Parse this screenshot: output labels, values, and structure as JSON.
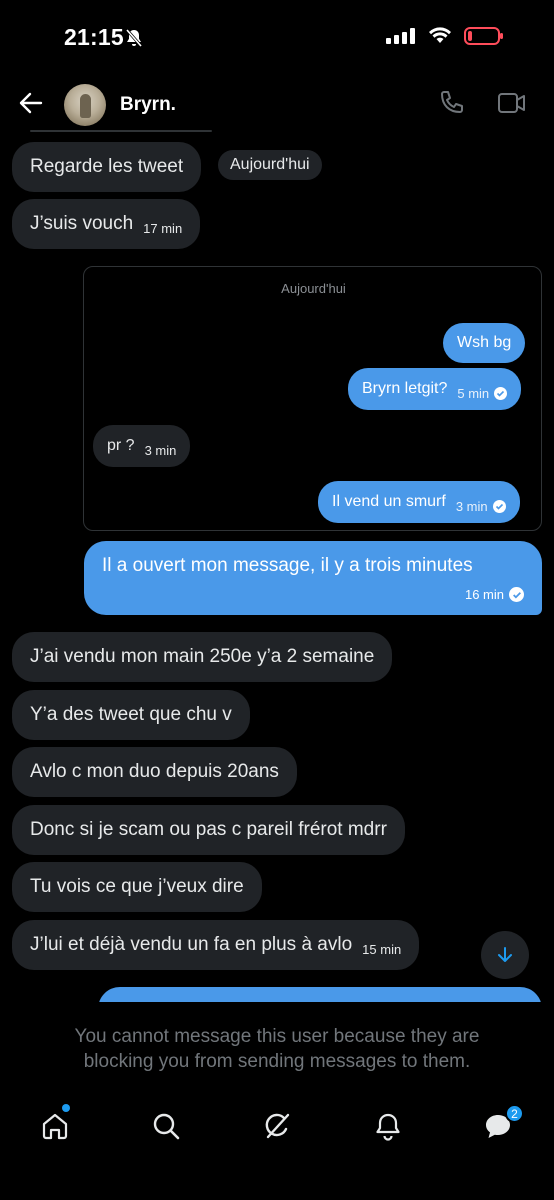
{
  "status_bar": {
    "time": "21:15"
  },
  "header": {
    "contact_name": "Bryrn."
  },
  "messages_top": [
    {
      "text": "Regarde les tweet"
    },
    {
      "text": "J’suis vouch",
      "time": "17 min"
    }
  ],
  "day_chip": "Aujourd'hui",
  "embed": {
    "day_label": "Aujourd'hui",
    "messages": [
      {
        "text": "Wsh bg"
      },
      {
        "text": "Bryrn letgit?",
        "time": "5 min"
      },
      {
        "text": "pr ?",
        "time": "3 min"
      },
      {
        "text": "Il vend un smurf",
        "time": "3 min"
      }
    ]
  },
  "sent_message": {
    "text": "Il a ouvert mon message, il y a trois minutes",
    "time": "16 min"
  },
  "messages_bottom": [
    {
      "text": "J’ai vendu mon main 250e y’a 2 semaine"
    },
    {
      "text": "Y’a des tweet que chu v"
    },
    {
      "text": "Avlo c mon duo depuis 20ans"
    },
    {
      "text": "Donc si je scam ou pas c pareil frérot mdrr"
    },
    {
      "text": "Tu vois ce que j’veux dire"
    },
    {
      "text": "J’lui et déjà vendu un fa en plus à avlo",
      "time": "15 min"
    }
  ],
  "blocked_notice": "You cannot message this user because they are blocking you from sending messages to them.",
  "tab_bar": {
    "messages_badge": "2"
  },
  "colors": {
    "accent": "#1d9bf0",
    "outgoing_bubble": "#4a99e9",
    "incoming_bubble": "#202327"
  },
  "icons": [
    "back-arrow-icon",
    "phone-icon",
    "video-icon",
    "home-icon",
    "search-icon",
    "grok-icon",
    "bell-icon",
    "messages-icon",
    "arrow-down-icon",
    "check-icon"
  ]
}
